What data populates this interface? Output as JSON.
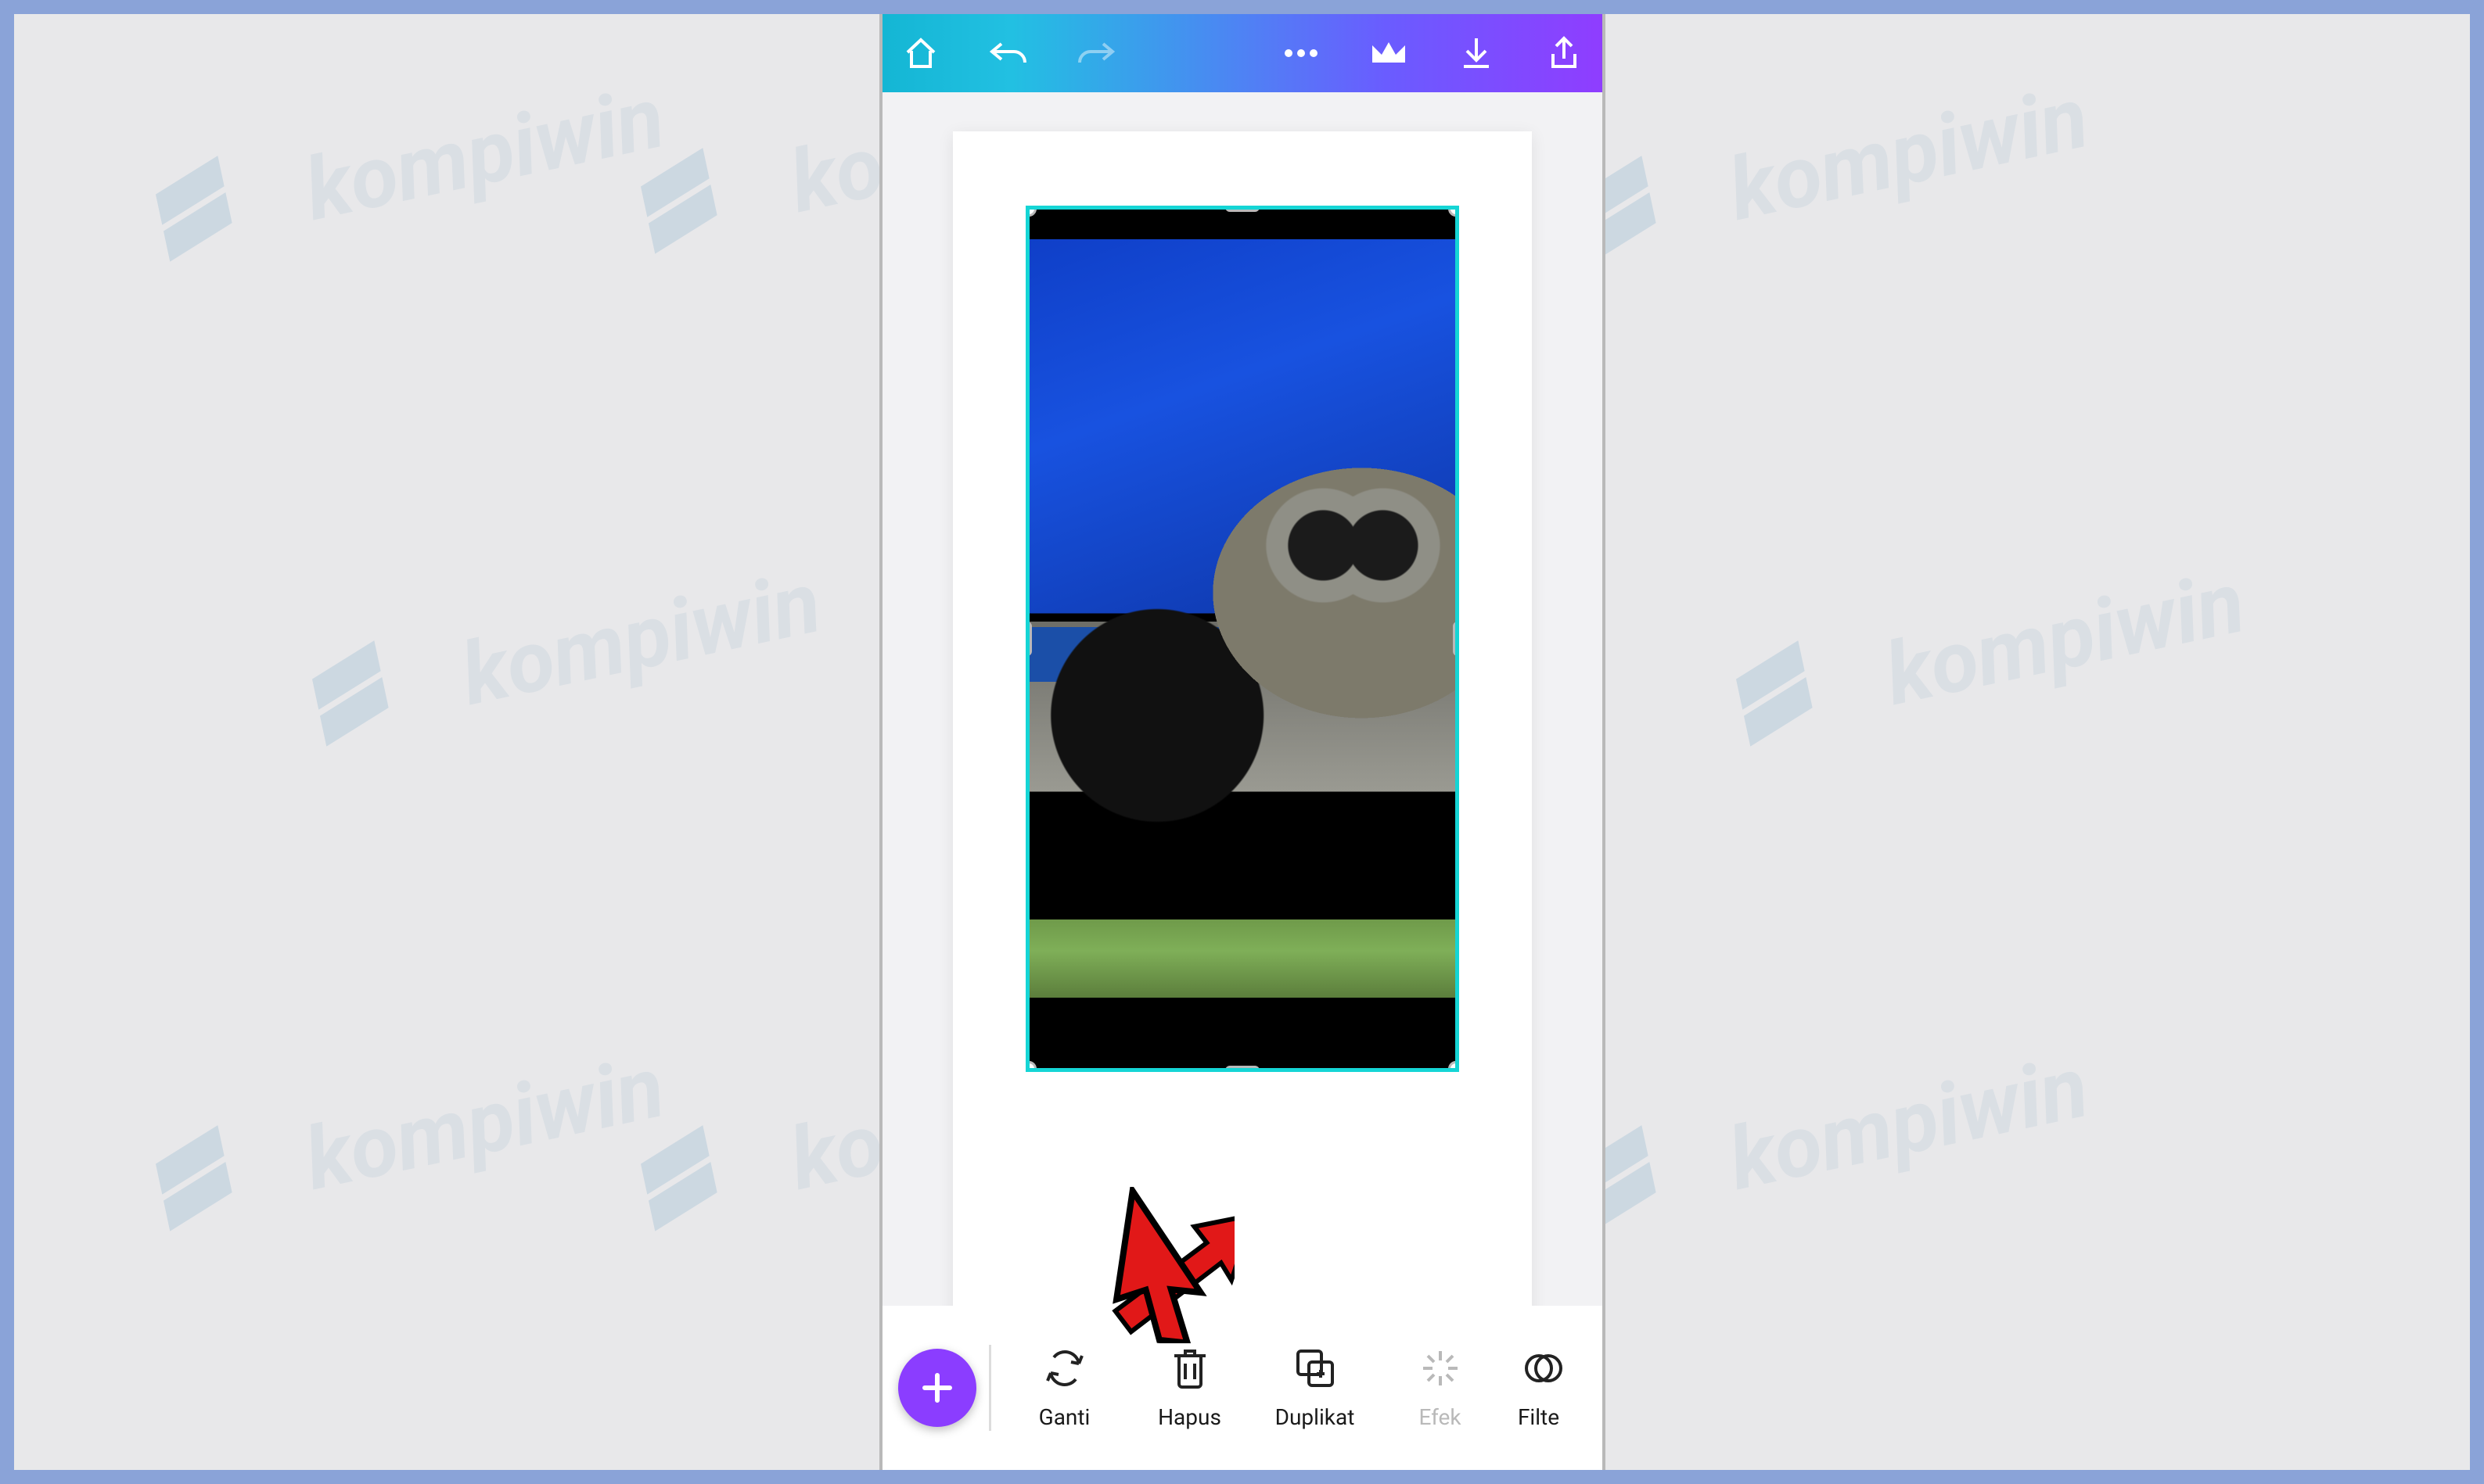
{
  "toolbar": {
    "ganti": "Ganti",
    "hapus": "Hapus",
    "duplikat": "Duplikat",
    "efek": "Efek",
    "filter": "Filte"
  },
  "watermark": "kompiwin",
  "colors": {
    "accent_purple": "#8b3dff",
    "selection_cyan": "#15d5d5",
    "frame_blue": "#8aa3d8"
  }
}
